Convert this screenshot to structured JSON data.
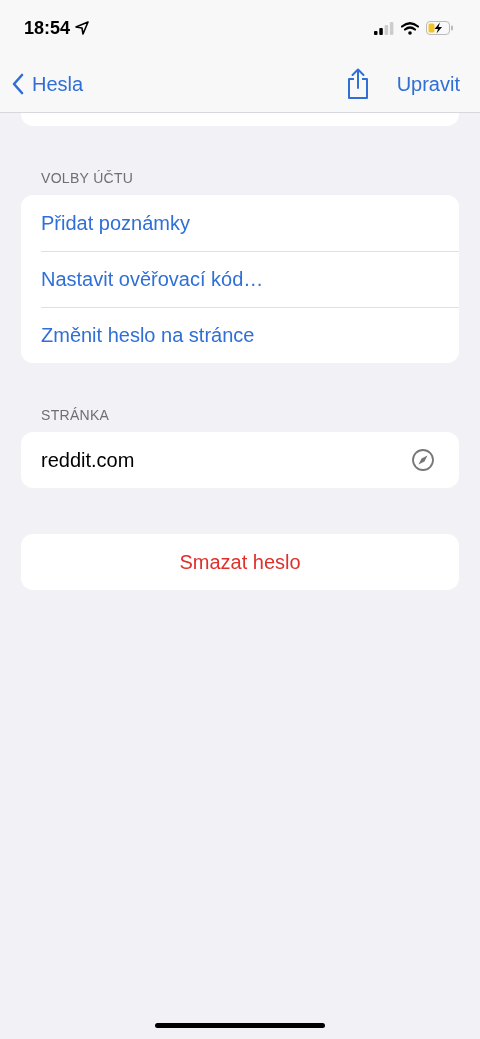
{
  "status_bar": {
    "time": "18:54"
  },
  "nav": {
    "back_label": "Hesla",
    "edit_label": "Upravit"
  },
  "sections": [
    {
      "header": "VOLBY ÚČTU",
      "rows": [
        {
          "label": "Přidat poznámky",
          "kind": "action"
        },
        {
          "label": "Nastavit ověřovací kód…",
          "kind": "action"
        },
        {
          "label": "Změnit heslo na stránce",
          "kind": "action"
        }
      ]
    },
    {
      "header": "STRÁNKA",
      "rows": [
        {
          "label": "reddit.com",
          "kind": "website"
        }
      ]
    }
  ],
  "delete_button": {
    "label": "Smazat heslo"
  }
}
